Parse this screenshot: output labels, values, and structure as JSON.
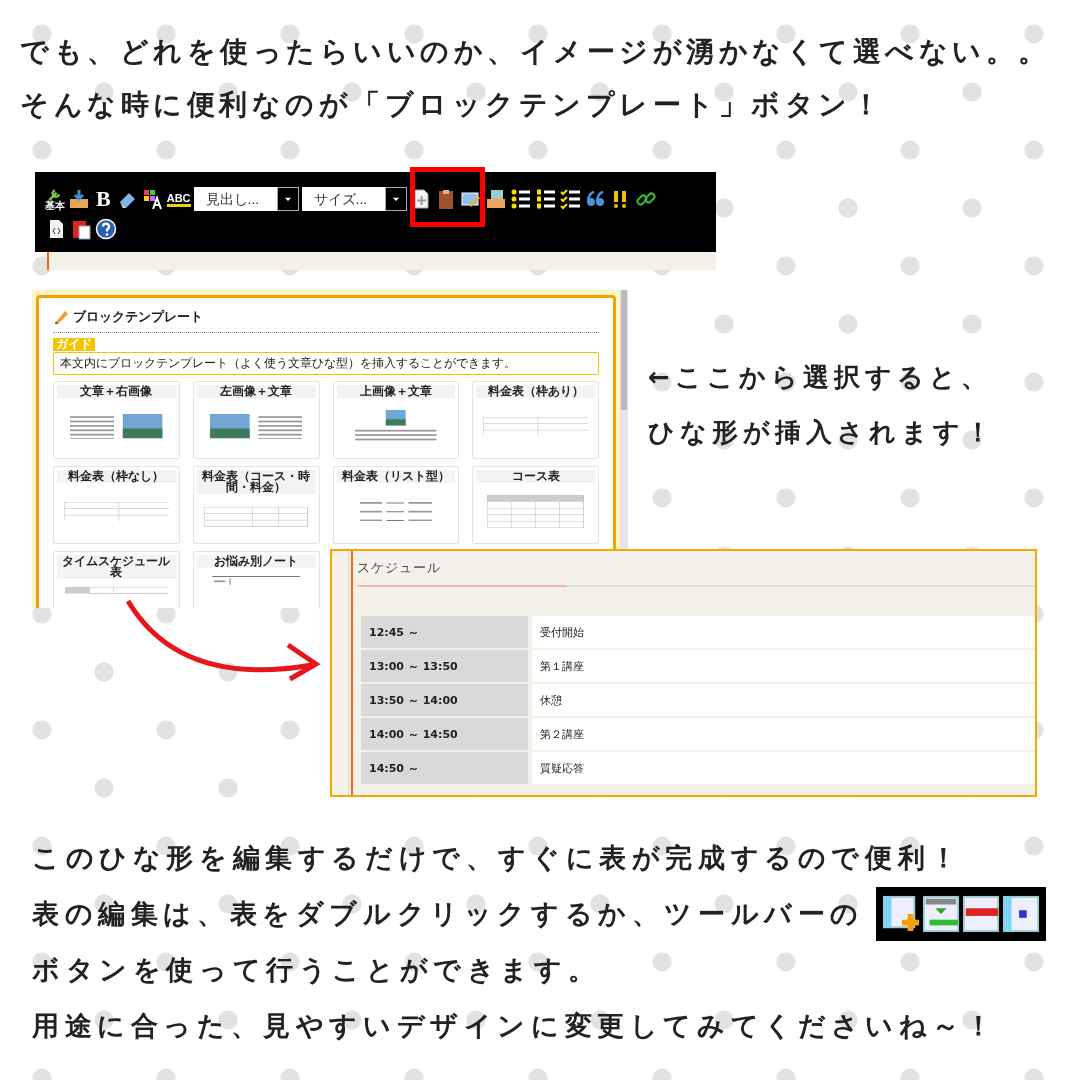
{
  "intro_lines": [
    "でも、どれを使ったらいいのか、イメージが湧かなくて選べない。。",
    "そんな時に便利なのが「ブロックテンプレート」ボタン！"
  ],
  "editor_toolbar": {
    "basic_label": "基本",
    "bold_label": "B",
    "spell_label": "ABC",
    "dropdowns": [
      {
        "value": "見出し..."
      },
      {
        "value": "サイズ..."
      }
    ],
    "block_template_button": {
      "highlighted": true
    }
  },
  "template_panel": {
    "title": "ブロックテンプレート",
    "guide_tab": "ガイド",
    "guide_text": "本文内にブロックテンプレート（よく使う文章ひな型）を挿入することができます。",
    "cards": [
      {
        "title": "文章＋右画像",
        "kind": "text-image"
      },
      {
        "title": "左画像＋文章",
        "kind": "image-text"
      },
      {
        "title": "上画像＋文章",
        "kind": "image-top"
      },
      {
        "title": "料金表（枠あり）",
        "kind": "price-framed"
      },
      {
        "title": "料金表（枠なし）",
        "kind": "price-plain"
      },
      {
        "title": "料金表（コース・時間・料金）",
        "kind": "price-course"
      },
      {
        "title": "料金表（リスト型）",
        "kind": "price-list"
      },
      {
        "title": "コース表",
        "kind": "course-table"
      },
      {
        "title": "タイムスケジュール表",
        "kind": "time-schedule"
      },
      {
        "title": "お悩み別ノート",
        "kind": "note"
      }
    ]
  },
  "side_note": [
    "←ここから選択すると、",
    "ひな形が挿入されます！"
  ],
  "schedule": {
    "title": "スケジュール",
    "rows": [
      {
        "time": "12:45 ～",
        "item": "受付開始"
      },
      {
        "time": "13:00 ～ 13:50",
        "item": "第１講座"
      },
      {
        "time": "13:50 ～ 14:00",
        "item": "休憩"
      },
      {
        "time": "14:00 ～ 14:50",
        "item": "第２講座"
      },
      {
        "time": "14:50 ～",
        "item": "質疑応答"
      }
    ]
  },
  "outro_lines": [
    {
      "text": "このひな形を編集するだけで、すぐに表が完成するので便利！",
      "table_tools": false
    },
    {
      "text": "表の編集は、表をダブルクリックするか、ツールバーの",
      "table_tools": true
    },
    {
      "text": "ボタンを使って行うことができます。",
      "table_tools": false
    },
    {
      "text": "用途に合った、見やすいデザインに変更してみてくださいね～！",
      "table_tools": false
    }
  ]
}
